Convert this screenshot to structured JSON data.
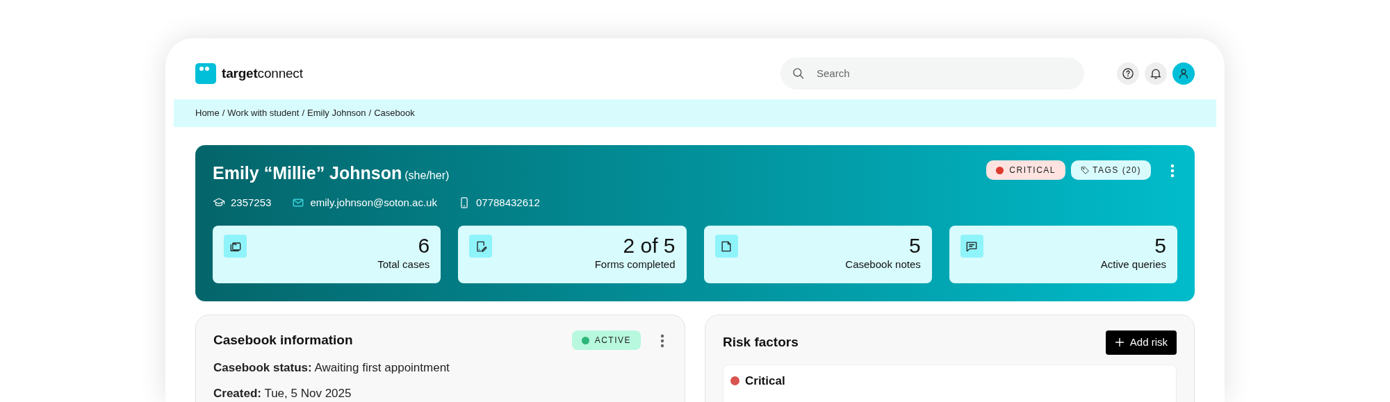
{
  "header": {
    "logo": {
      "bold": "target",
      "light": "connect"
    },
    "search": {
      "placeholder": "Search"
    },
    "actions": [
      {
        "kind": "help"
      },
      {
        "kind": "bell"
      },
      {
        "kind": "user"
      }
    ]
  },
  "breadcrumb": [
    {
      "kind": "link",
      "label": "Home"
    },
    {
      "kind": "separator",
      "label": "/"
    },
    {
      "kind": "text",
      "label": "Work with student"
    },
    {
      "kind": "separator",
      "label": "/"
    },
    {
      "kind": "link",
      "label": "Emily Johnson"
    },
    {
      "kind": "separator",
      "label": "/"
    },
    {
      "kind": "text",
      "label": "Casebook"
    }
  ],
  "student": {
    "name": "Emily “Millie” Johnson",
    "pronouns": "(she/her)",
    "student_id": "2357253",
    "email": "emily.johnson@soton.ac.uk",
    "phone": "07788432612",
    "badges": [
      {
        "kind": "status",
        "label": "CRITICAL",
        "color": "#dc3b2f"
      },
      {
        "kind": "tags",
        "label": "TAGS (20)"
      }
    ],
    "stats": [
      {
        "kind": "cases",
        "value": "6",
        "label": "Total cases"
      },
      {
        "kind": "forms",
        "value": "2 of 5",
        "label": "Forms completed"
      },
      {
        "kind": "notes",
        "value": "5",
        "label": "Casebook notes"
      },
      {
        "kind": "queries",
        "value": "5",
        "label": "Active queries"
      }
    ]
  },
  "casebook_info": {
    "title": "Casebook information",
    "badge": {
      "label": "ACTIVE",
      "color": "#2fb57a"
    },
    "fields": [
      {
        "label": "Casebook status:",
        "value": "Awaiting first appointment"
      },
      {
        "label": "Created:",
        "value": "Tue, 5 Nov 2025"
      }
    ]
  },
  "risk_factors": {
    "title": "Risk factors",
    "button": "Add risk",
    "items": [
      {
        "label": "Critical",
        "color": "#d9534f"
      }
    ]
  }
}
